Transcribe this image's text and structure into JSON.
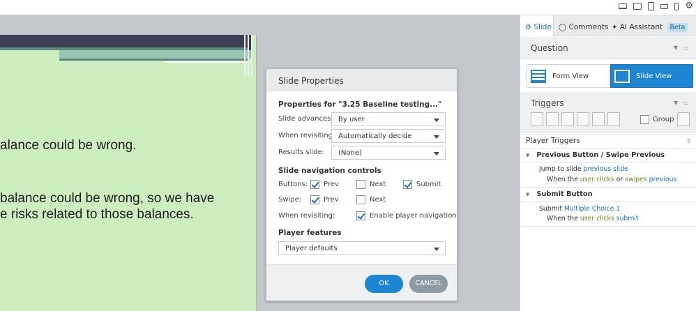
{
  "slide": {
    "line1": "alance could be wrong.",
    "line2": "balance could be wrong, so we have",
    "line3": "e risks related to those balances."
  },
  "dialog": {
    "title": "Slide Properties",
    "properties_for": "Properties for \"3.25 Baseline testing...\"",
    "slide_advances_label": "Slide advances:",
    "slide_advances_value": "By user",
    "when_revisiting_label": "When revisiting:",
    "when_revisiting_value": "Automatically decide",
    "results_slide_label": "Results slide:",
    "results_slide_value": "(None)",
    "nav_controls_heading": "Slide navigation controls",
    "buttons_label": "Buttons:",
    "swipe_label": "Swipe:",
    "prev_label": "Prev",
    "next_label": "Next",
    "submit_label": "Submit",
    "revisiting_label2": "When revisiting:",
    "enable_player_nav": "Enable player navigation",
    "player_features_heading": "Player features",
    "player_features_value": "Player defaults",
    "ok_label": "OK",
    "cancel_label": "CANCEL"
  },
  "panel": {
    "tabs": [
      {
        "label": "Slide"
      },
      {
        "label": "Comments"
      },
      {
        "label": "AI Assistant",
        "badge": "Beta"
      }
    ],
    "question_heading": "Question",
    "form_view_label": "Form View",
    "slide_view_label": "Slide View",
    "triggers_heading": "Triggers",
    "group_label": "Group",
    "player_triggers_heading": "Player Triggers",
    "groups": [
      {
        "title": "Previous Button / Swipe Previous",
        "action_prefix": "Jump to slide ",
        "action_link": "previous slide",
        "when_prefix": "When the ",
        "when_actor": "user",
        "when_verb": " clicks",
        "when_mid": " or ",
        "when_verb2": "swipes",
        "when_target": " previous"
      },
      {
        "title": "Submit Button",
        "action_prefix": "Submit ",
        "action_link": "Multiple Choice 1",
        "when_prefix": "When the ",
        "when_actor": "user",
        "when_verb": " clicks",
        "when_target": " submit"
      }
    ]
  },
  "colors": {
    "accent": "#1e85d3",
    "slide_bg": "#cdeebf",
    "link": "#1a6fc0"
  }
}
